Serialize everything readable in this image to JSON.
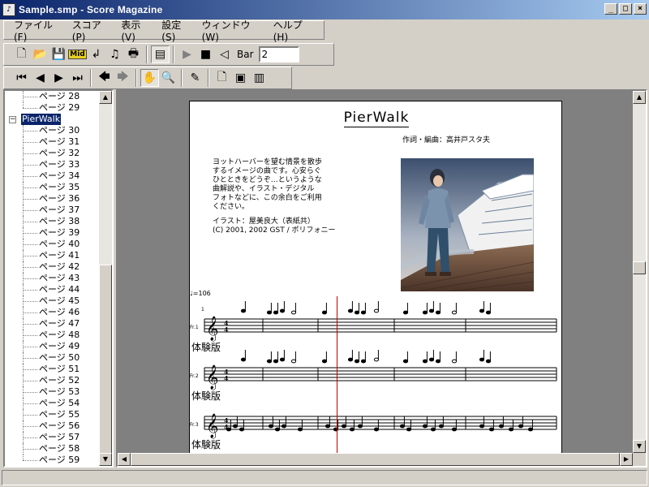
{
  "window": {
    "title": "Sample.smp - Score Magazine",
    "minimize": "_",
    "maximize": "□",
    "close": "×"
  },
  "menu": [
    "ファイル(F)",
    "スコア(P)",
    "表示(V)",
    "設定(S)",
    "ウィンドウ(W)",
    "ヘルプ(H)"
  ],
  "toolbar1": {
    "bar_label": "Bar",
    "bar_value": "2"
  },
  "tree": {
    "before": [
      "ページ 28",
      "ページ 29"
    ],
    "group": "PierWalk",
    "pages": [
      "ページ 30",
      "ページ 31",
      "ページ 32",
      "ページ 33",
      "ページ 34",
      "ページ 35",
      "ページ 36",
      "ページ 37",
      "ページ 38",
      "ページ 39",
      "ページ 40",
      "ページ 41",
      "ページ 42",
      "ページ 43",
      "ページ 44",
      "ページ 45",
      "ページ 46",
      "ページ 47",
      "ページ 48",
      "ページ 49",
      "ページ 50",
      "ページ 51",
      "ページ 52",
      "ページ 53",
      "ページ 54",
      "ページ 55",
      "ページ 56",
      "ページ 57",
      "ページ 58",
      "ページ 59"
    ]
  },
  "score": {
    "title": "PierWalk",
    "composer": "作詞・編曲：高井戸スタ夫",
    "description": [
      "ヨットハーバーを望む情景を散歩",
      "するイメージの曲です。心安らぐ",
      "ひとときをどうぞ…というような",
      "曲解説や、イラスト・デジタル",
      "フォトなどに、この余白をご利用",
      "ください。"
    ],
    "credit": [
      "イラスト：屋美良大（表紙共）",
      "(C) 2001, 2002 GST / ポリフォニー"
    ],
    "tempo": "♩=106",
    "measure_number": "1",
    "parts": [
      "Fr.1",
      "Fr.2",
      "Fr.3"
    ],
    "watermark": "体験版"
  },
  "colors": {
    "title_bar_start": "#0a246a",
    "title_bar_end": "#a6caf0",
    "selection": "#0a246a",
    "playhead": "#c00000",
    "workspace": "#808080"
  }
}
